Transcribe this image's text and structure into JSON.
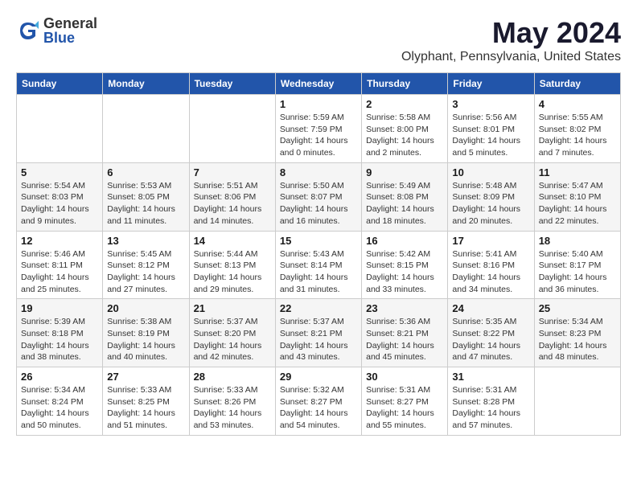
{
  "logo": {
    "general": "General",
    "blue": "Blue"
  },
  "title": "May 2024",
  "subtitle": "Olyphant, Pennsylvania, United States",
  "headers": [
    "Sunday",
    "Monday",
    "Tuesday",
    "Wednesday",
    "Thursday",
    "Friday",
    "Saturday"
  ],
  "weeks": [
    [
      {
        "day": "",
        "info": ""
      },
      {
        "day": "",
        "info": ""
      },
      {
        "day": "",
        "info": ""
      },
      {
        "day": "1",
        "info": "Sunrise: 5:59 AM\nSunset: 7:59 PM\nDaylight: 14 hours\nand 0 minutes."
      },
      {
        "day": "2",
        "info": "Sunrise: 5:58 AM\nSunset: 8:00 PM\nDaylight: 14 hours\nand 2 minutes."
      },
      {
        "day": "3",
        "info": "Sunrise: 5:56 AM\nSunset: 8:01 PM\nDaylight: 14 hours\nand 5 minutes."
      },
      {
        "day": "4",
        "info": "Sunrise: 5:55 AM\nSunset: 8:02 PM\nDaylight: 14 hours\nand 7 minutes."
      }
    ],
    [
      {
        "day": "5",
        "info": "Sunrise: 5:54 AM\nSunset: 8:03 PM\nDaylight: 14 hours\nand 9 minutes."
      },
      {
        "day": "6",
        "info": "Sunrise: 5:53 AM\nSunset: 8:05 PM\nDaylight: 14 hours\nand 11 minutes."
      },
      {
        "day": "7",
        "info": "Sunrise: 5:51 AM\nSunset: 8:06 PM\nDaylight: 14 hours\nand 14 minutes."
      },
      {
        "day": "8",
        "info": "Sunrise: 5:50 AM\nSunset: 8:07 PM\nDaylight: 14 hours\nand 16 minutes."
      },
      {
        "day": "9",
        "info": "Sunrise: 5:49 AM\nSunset: 8:08 PM\nDaylight: 14 hours\nand 18 minutes."
      },
      {
        "day": "10",
        "info": "Sunrise: 5:48 AM\nSunset: 8:09 PM\nDaylight: 14 hours\nand 20 minutes."
      },
      {
        "day": "11",
        "info": "Sunrise: 5:47 AM\nSunset: 8:10 PM\nDaylight: 14 hours\nand 22 minutes."
      }
    ],
    [
      {
        "day": "12",
        "info": "Sunrise: 5:46 AM\nSunset: 8:11 PM\nDaylight: 14 hours\nand 25 minutes."
      },
      {
        "day": "13",
        "info": "Sunrise: 5:45 AM\nSunset: 8:12 PM\nDaylight: 14 hours\nand 27 minutes."
      },
      {
        "day": "14",
        "info": "Sunrise: 5:44 AM\nSunset: 8:13 PM\nDaylight: 14 hours\nand 29 minutes."
      },
      {
        "day": "15",
        "info": "Sunrise: 5:43 AM\nSunset: 8:14 PM\nDaylight: 14 hours\nand 31 minutes."
      },
      {
        "day": "16",
        "info": "Sunrise: 5:42 AM\nSunset: 8:15 PM\nDaylight: 14 hours\nand 33 minutes."
      },
      {
        "day": "17",
        "info": "Sunrise: 5:41 AM\nSunset: 8:16 PM\nDaylight: 14 hours\nand 34 minutes."
      },
      {
        "day": "18",
        "info": "Sunrise: 5:40 AM\nSunset: 8:17 PM\nDaylight: 14 hours\nand 36 minutes."
      }
    ],
    [
      {
        "day": "19",
        "info": "Sunrise: 5:39 AM\nSunset: 8:18 PM\nDaylight: 14 hours\nand 38 minutes."
      },
      {
        "day": "20",
        "info": "Sunrise: 5:38 AM\nSunset: 8:19 PM\nDaylight: 14 hours\nand 40 minutes."
      },
      {
        "day": "21",
        "info": "Sunrise: 5:37 AM\nSunset: 8:20 PM\nDaylight: 14 hours\nand 42 minutes."
      },
      {
        "day": "22",
        "info": "Sunrise: 5:37 AM\nSunset: 8:21 PM\nDaylight: 14 hours\nand 43 minutes."
      },
      {
        "day": "23",
        "info": "Sunrise: 5:36 AM\nSunset: 8:21 PM\nDaylight: 14 hours\nand 45 minutes."
      },
      {
        "day": "24",
        "info": "Sunrise: 5:35 AM\nSunset: 8:22 PM\nDaylight: 14 hours\nand 47 minutes."
      },
      {
        "day": "25",
        "info": "Sunrise: 5:34 AM\nSunset: 8:23 PM\nDaylight: 14 hours\nand 48 minutes."
      }
    ],
    [
      {
        "day": "26",
        "info": "Sunrise: 5:34 AM\nSunset: 8:24 PM\nDaylight: 14 hours\nand 50 minutes."
      },
      {
        "day": "27",
        "info": "Sunrise: 5:33 AM\nSunset: 8:25 PM\nDaylight: 14 hours\nand 51 minutes."
      },
      {
        "day": "28",
        "info": "Sunrise: 5:33 AM\nSunset: 8:26 PM\nDaylight: 14 hours\nand 53 minutes."
      },
      {
        "day": "29",
        "info": "Sunrise: 5:32 AM\nSunset: 8:27 PM\nDaylight: 14 hours\nand 54 minutes."
      },
      {
        "day": "30",
        "info": "Sunrise: 5:31 AM\nSunset: 8:27 PM\nDaylight: 14 hours\nand 55 minutes."
      },
      {
        "day": "31",
        "info": "Sunrise: 5:31 AM\nSunset: 8:28 PM\nDaylight: 14 hours\nand 57 minutes."
      },
      {
        "day": "",
        "info": ""
      }
    ]
  ]
}
